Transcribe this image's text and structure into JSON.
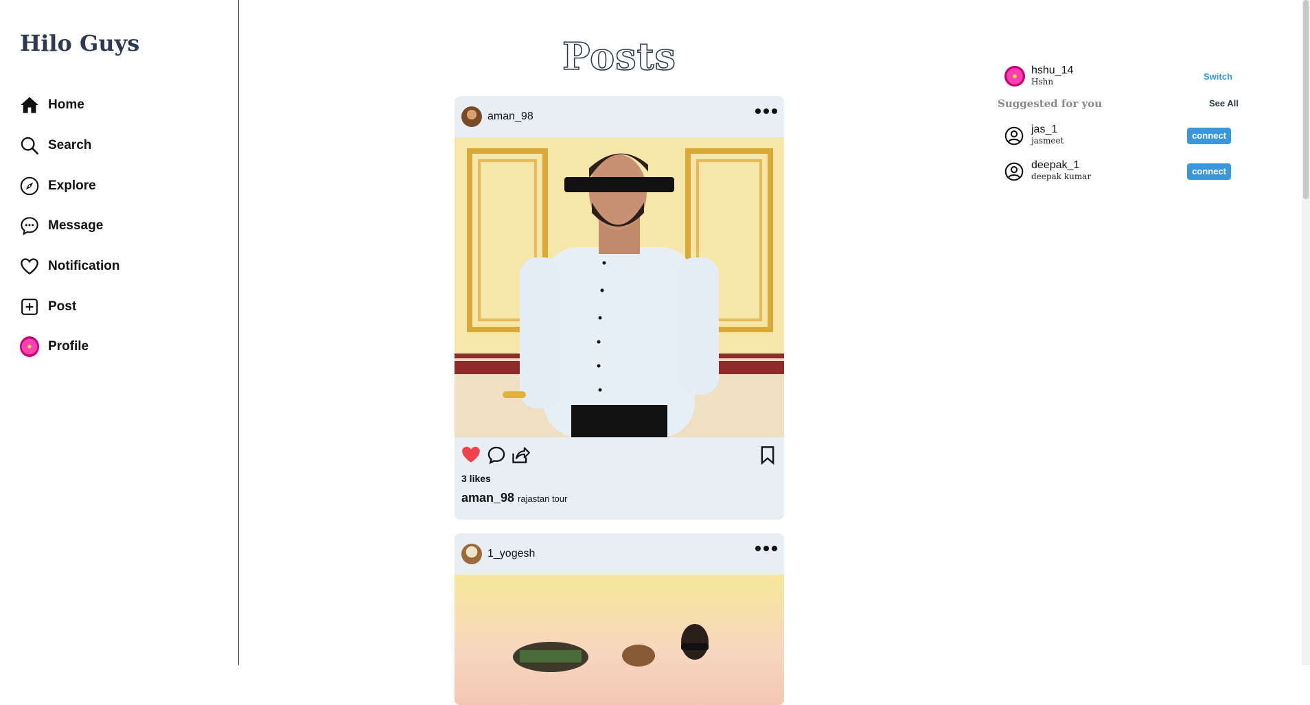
{
  "brand": "Hilo Guys",
  "nav": [
    {
      "label": "Home",
      "icon": "home-icon"
    },
    {
      "label": "Search",
      "icon": "search-icon"
    },
    {
      "label": "Explore",
      "icon": "compass-icon"
    },
    {
      "label": "Message",
      "icon": "chat-icon"
    },
    {
      "label": "Notification",
      "icon": "heart-icon"
    },
    {
      "label": "Post",
      "icon": "plus-square-icon"
    },
    {
      "label": "Profile",
      "icon": "profile-avatar"
    }
  ],
  "page_title": "Posts",
  "posts": [
    {
      "username": "aman_98",
      "likes": "3 likes",
      "caption_user": "aman_98",
      "caption_text": "rajastan tour",
      "liked": true
    },
    {
      "username": "1_yogesh"
    }
  ],
  "current_user": {
    "username": "hshu_14",
    "name": "Hshn",
    "switch_label": "Switch"
  },
  "suggestions": {
    "title": "Suggested for you",
    "see_all": "See All",
    "items": [
      {
        "username": "jas_1",
        "name": "jasmeet",
        "action": "connect"
      },
      {
        "username": "deepak_1",
        "name": "deepak kumar",
        "action": "connect"
      }
    ]
  },
  "colors": {
    "accent": "#3a97dc",
    "brand": "#2d3a4f",
    "like": "#f0424a",
    "card": "#e9eef5"
  }
}
